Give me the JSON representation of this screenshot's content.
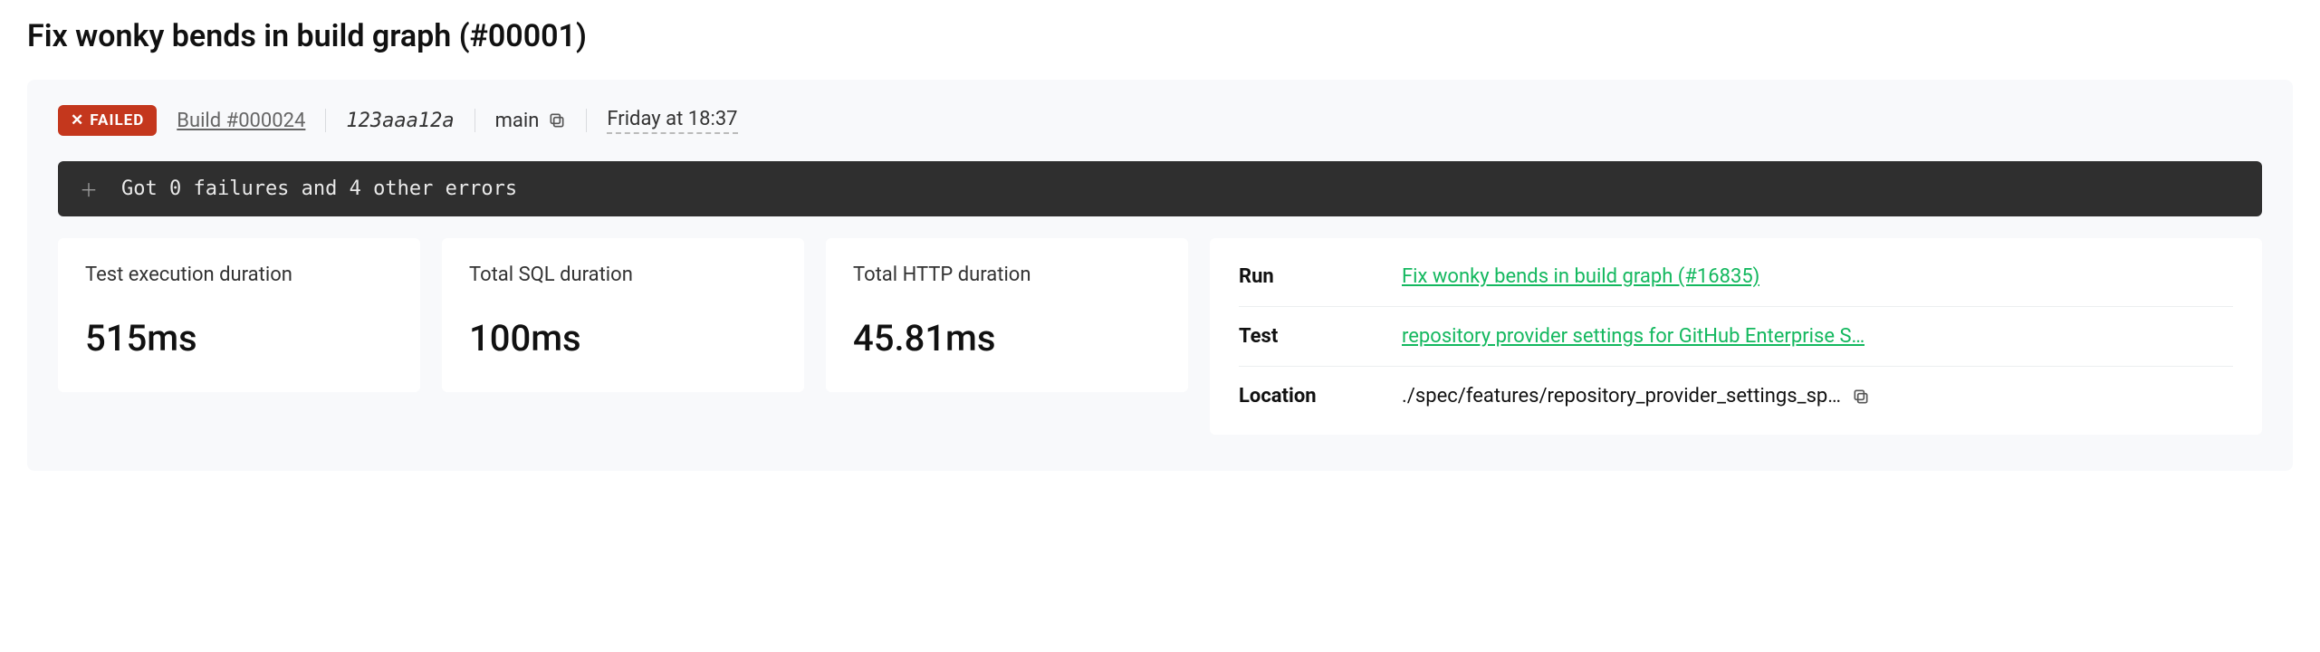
{
  "title": "Fix wonky bends in build graph (#00001)",
  "meta": {
    "status_label": "FAILED",
    "build_link": "Build #000024",
    "commit": "123aaa12a",
    "branch": "main",
    "timestamp": "Friday at 18:37"
  },
  "error_bar": {
    "message": "Got 0 failures and 4 other errors"
  },
  "stats": [
    {
      "label": "Test execution duration",
      "value": "515ms"
    },
    {
      "label": "Total SQL duration",
      "value": "100ms"
    },
    {
      "label": "Total HTTP duration",
      "value": "45.81ms"
    }
  ],
  "info": {
    "run_label": "Run",
    "run_value": "Fix wonky bends in build graph (#16835)",
    "test_label": "Test",
    "test_value": "repository provider settings for GitHub Enterprise S…",
    "location_label": "Location",
    "location_value": "./spec/features/repository_provider_settings_sp…"
  }
}
